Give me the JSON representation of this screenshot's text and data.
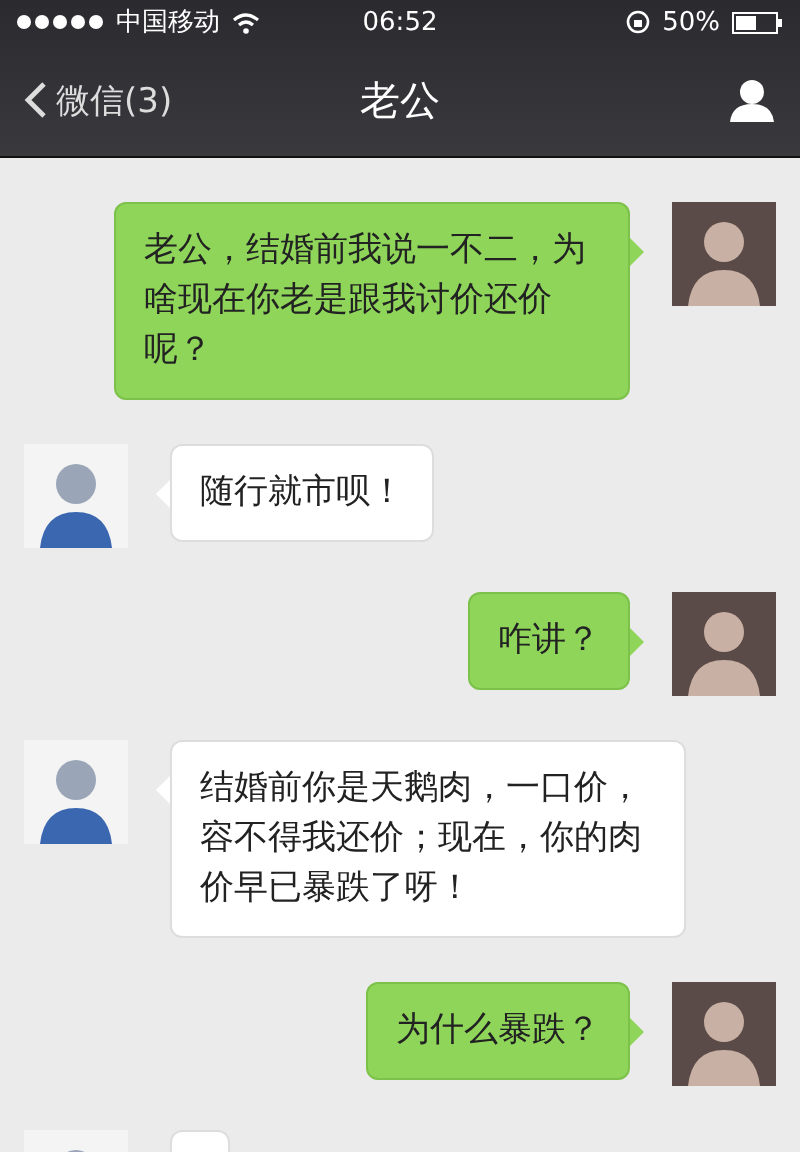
{
  "status_bar": {
    "carrier": "中国移动",
    "time": "06:52",
    "battery": "50%"
  },
  "nav_bar": {
    "back": "微信(3)",
    "title": "老公"
  },
  "messages": [
    {
      "kind": "sent",
      "text": "老公，结婚前我说一不二，为啥现在你老是跟我讨价还价呢？"
    },
    {
      "kind": "received",
      "text": "随行就市呗！"
    },
    {
      "kind": "sent",
      "text": "咋讲？"
    },
    {
      "kind": "received",
      "text": "结婚前你是天鹅肉，一口价，容不得我还价；现在，你的肉价早已暴跌了呀！"
    },
    {
      "kind": "sent",
      "text": "为什么暴跌？"
    },
    {
      "kind": "received"
    }
  ]
}
